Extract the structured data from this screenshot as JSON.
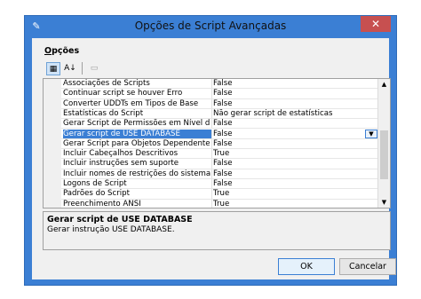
{
  "window": {
    "title": "Opções de Script Avançadas",
    "close_glyph": "✕",
    "app_icon": "script-icon"
  },
  "group": {
    "label_underlined": "O",
    "label_rest": "pções"
  },
  "toolbar": {
    "categorized_icon": "categorized-icon",
    "alphabetical_icon": "alphabetical-sort-icon",
    "property_pages_icon": "property-pages-icon"
  },
  "properties": [
    {
      "name": "Associações de Scripts",
      "value": "False"
    },
    {
      "name": "Continuar script se houver Erro",
      "value": "False"
    },
    {
      "name": "Converter UDDTs em Tipos de Base",
      "value": "False"
    },
    {
      "name": "Estatísticas do Script",
      "value": "Não gerar script de estatísticas"
    },
    {
      "name": "Gerar Script de Permissões em Nível d",
      "value": "False"
    },
    {
      "name": "Gerar script de USE DATABASE",
      "value": "False"
    },
    {
      "name": "Gerar Script para Objetos Dependente",
      "value": "False"
    },
    {
      "name": "Incluir Cabeçalhos Descritivos",
      "value": "True"
    },
    {
      "name": "Incluir instruções sem suporte",
      "value": "False"
    },
    {
      "name": "Incluir nomes de restrições do sistema",
      "value": "False"
    },
    {
      "name": "Logons de Script",
      "value": "False"
    },
    {
      "name": "Padrões do Script",
      "value": "True"
    },
    {
      "name": "Preenchimento ANSI",
      "value": "True"
    }
  ],
  "description": {
    "title": "Gerar script de USE DATABASE",
    "text": "Gerar instrução USE DATABASE."
  },
  "buttons": {
    "ok": "OK",
    "cancel": "Cancelar"
  },
  "colors": {
    "titlebar": "#3b7fd4",
    "selection": "#3b7fd4",
    "close": "#c75050"
  }
}
